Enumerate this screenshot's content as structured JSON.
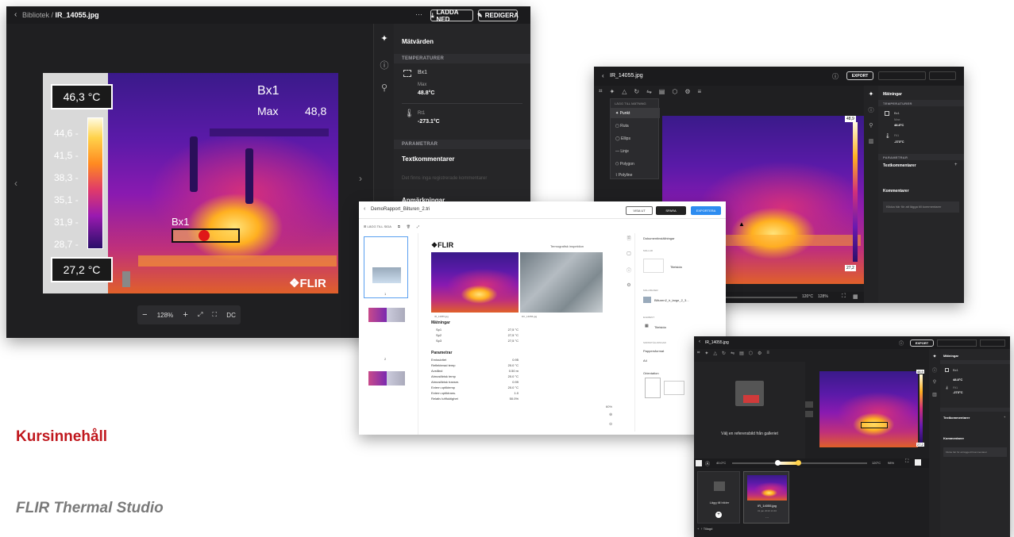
{
  "slide": {
    "heading": "Kursinnehåll",
    "subheading": "FLIR Thermal Studio",
    "heading_color": "#c0171d"
  },
  "main_window": {
    "breadcrumb_parent": "Bibliotek",
    "breadcrumb_sep": " / ",
    "file_name": "IR_14055.jpg",
    "more_label": "···",
    "download_label": "LADDA NED",
    "edit_label": "REDIGERA",
    "temp_max_label": "46,3 °C",
    "temp_min_label": "27,2 °C",
    "scale_ticks": [
      "44,6 -",
      "41,5 -",
      "38,3 -",
      "35,1 -",
      "31,9 -",
      "28,7 -"
    ],
    "overlay_box_name": "Bx1",
    "overlay_max_label": "Max",
    "overlay_max_value": "48,8",
    "box_label": "Bx1",
    "logo": "FLIR",
    "zoom_minus": "−",
    "zoom_value": "128%",
    "zoom_plus": "+",
    "dc_label": "DC",
    "side": {
      "title": "Mätvärden",
      "temps_section": "TEMPERATURER",
      "box_name": "Bx1",
      "max_label": "Max",
      "max_value": "48.8°C",
      "rt_name": "Rt1",
      "rt_value": "-273.1°C",
      "params_section": "PARAMETRAR",
      "text_comments": "Textkommentarer",
      "text_comments_hint": "Det finns inga registrerade kommentarer",
      "notes": "Anmärkningar"
    }
  },
  "edit_window": {
    "file_name": "IR_14055.jpg",
    "export_label": "EXPORT",
    "menu_header": "LÄGG TILL MÄTNING",
    "menu_items": [
      "Punkt",
      "Ruta",
      "Ellips",
      "Linje",
      "Polygon",
      "Polyline"
    ],
    "scale_top": "48,9",
    "scale_bottom": "27,2",
    "bottom_temp": "120°C",
    "bottom_zoom": "128%",
    "side_title": "Mätningar",
    "side_section": "TEMPERATURER",
    "box_name": "Bx1",
    "max_label": "Max",
    "max_value": "48.8°C",
    "rt_name": "Rt1",
    "rt_value": "-273°C",
    "param_section": "PARAMETRAR",
    "text_comments": "Textkommentarer",
    "comments": "Kommentarer",
    "comment_hint": "Klicka här för att lägga till kommentarer"
  },
  "report_window": {
    "title": "DemoRapport_Bilturen_2.tri",
    "add_page": "LÄGG TILL SIDA",
    "btn_export": "EXPORTERA",
    "btn_save": "SPARA",
    "btn_preview": "VISA UT",
    "logo": "FLIR",
    "page_caption": "Termografisk inspektion",
    "measurements_title": "Mätningar",
    "measurements": [
      {
        "name": "Sp1",
        "value": "27,5 °C"
      },
      {
        "name": "Sp2",
        "value": "27,5 °C"
      },
      {
        "name": "Sp3",
        "value": "27,5 °C"
      }
    ],
    "params_title": "Parametrar",
    "params": [
      {
        "name": "Emissivitet",
        "value": "0.95"
      },
      {
        "name": "Reflekterad temp",
        "value": "20.0 °C"
      },
      {
        "name": "Avstånd",
        "value": "0.50 m"
      },
      {
        "name": "Atmosfärisk temp",
        "value": "20.0 °C"
      },
      {
        "name": "Atmosfärisk transm.",
        "value": "0.99"
      },
      {
        "name": "Extern optiktemp",
        "value": "20.0 °C"
      },
      {
        "name": "Extern optiktrans.",
        "value": "1.0"
      },
      {
        "name": "Relativ luftfuktighet",
        "value": "50.0%"
      }
    ],
    "caption_left": "IR_14055.jpg",
    "caption_right": "DC_14056.jpg",
    "zoom_value": "60%",
    "page_num": "1",
    "page_num2": "2",
    "right": {
      "item1": "Dokumentinställningar",
      "sec1": "MALLAR",
      "template": "Titelsida",
      "sec2": "MALLBILDER",
      "file": "Bilturen2_ir_large_2_3...",
      "sec3": "ELEMENT",
      "element": "Titelsida",
      "sec4": "SIDINSTÄLLNINGAR",
      "paper": "Pappersformat",
      "paper_value": "A4",
      "orientation": "Orientation"
    }
  },
  "gallery_window": {
    "file_name": "IR_14055.jpg",
    "export_label": "EXPORT",
    "placeholder_text": "Välj en referensbild från galleriet",
    "scale_top": "48,9",
    "scale_bottom": "27,2",
    "bottom_left_temp": "40.0°C",
    "bottom_right_temp": "120°C",
    "zoom": "98%",
    "add_images": "Lägg till bilder",
    "thumb_name": "IR_14055.jpg",
    "thumb_date": "31 jan 2019 13:46",
    "thumb_more": "···",
    "footer_label": "Tillagd",
    "side_title": "Mätningar",
    "box_name": "Bx1",
    "max_value": "48.8°C",
    "rt_name": "Rt1",
    "rt_value": "-273°C",
    "text_comments": "Textkommentarer",
    "comments": "Kommentarer",
    "comment_hint": "Klicka här för att lägga till kommentarer"
  }
}
